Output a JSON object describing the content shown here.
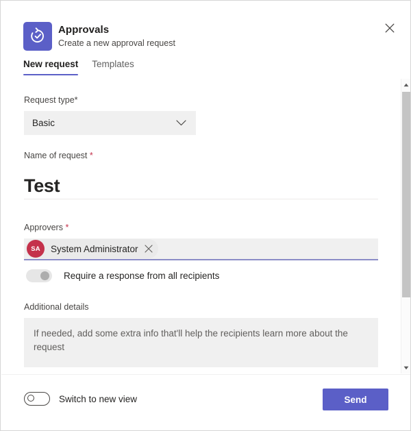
{
  "app": {
    "icon_name": "approvals-refresh-check-icon",
    "title": "Approvals",
    "subtitle": "Create a new approval request",
    "brand_color": "#5b5fc7",
    "close_label": "Close"
  },
  "tabs": [
    {
      "label": "New request",
      "active": true
    },
    {
      "label": "Templates",
      "active": false
    }
  ],
  "form": {
    "request_type": {
      "label": "Request type*",
      "value": "Basic",
      "chevron": "chevron-down"
    },
    "name_of_request": {
      "label": "Name of request ",
      "required_marker": "*",
      "value": "Test"
    },
    "approvers": {
      "label": "Approvers ",
      "required_marker": "*",
      "chips": [
        {
          "initials": "SA",
          "name": "System Administrator",
          "avatar_color": "#c4314b",
          "remove_label": "Remove"
        }
      ]
    },
    "require_response": {
      "label": "Require a response from all recipients",
      "state": "off"
    },
    "additional_details": {
      "label": "Additional details",
      "value": "",
      "placeholder": "If needed, add some extra info that'll help the recipients learn more about the request"
    }
  },
  "footer": {
    "switch_view": {
      "label": "Switch to new view",
      "state": "off"
    },
    "send_label": "Send"
  },
  "scrollbar": {
    "up_label": "Scroll up",
    "down_label": "Scroll down"
  }
}
